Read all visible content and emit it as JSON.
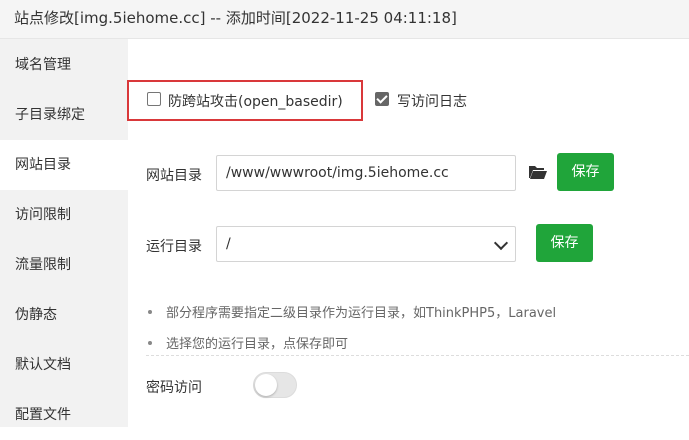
{
  "window": {
    "title": "站点修改[img.5iehome.cc] -- 添加时间[2022-11-25 04:11:18]"
  },
  "sidebar": {
    "items": [
      {
        "label": "域名管理",
        "active": false
      },
      {
        "label": "子目录绑定",
        "active": false
      },
      {
        "label": "网站目录",
        "active": true
      },
      {
        "label": "访问限制",
        "active": false
      },
      {
        "label": "流量限制",
        "active": false
      },
      {
        "label": "伪静态",
        "active": false
      },
      {
        "label": "默认文档",
        "active": false
      },
      {
        "label": "配置文件",
        "active": false
      }
    ]
  },
  "options": {
    "anti_xss": {
      "label": "防跨站攻击(open_basedir)",
      "checked": false
    },
    "access_log": {
      "label": "写访问日志",
      "checked": true
    }
  },
  "site_dir": {
    "label": "网站目录",
    "value": "/www/wwwroot/img.5iehome.cc",
    "save_label": "保存"
  },
  "run_dir": {
    "label": "运行目录",
    "selected": "/",
    "save_label": "保存"
  },
  "tips": [
    "部分程序需要指定二级目录作为运行目录，如ThinkPHP5，Laravel",
    "选择您的运行目录，点保存即可"
  ],
  "password_access": {
    "label": "密码访问",
    "enabled": false
  },
  "colors": {
    "accent": "#20a53a",
    "highlight_border": "#d9383a"
  }
}
